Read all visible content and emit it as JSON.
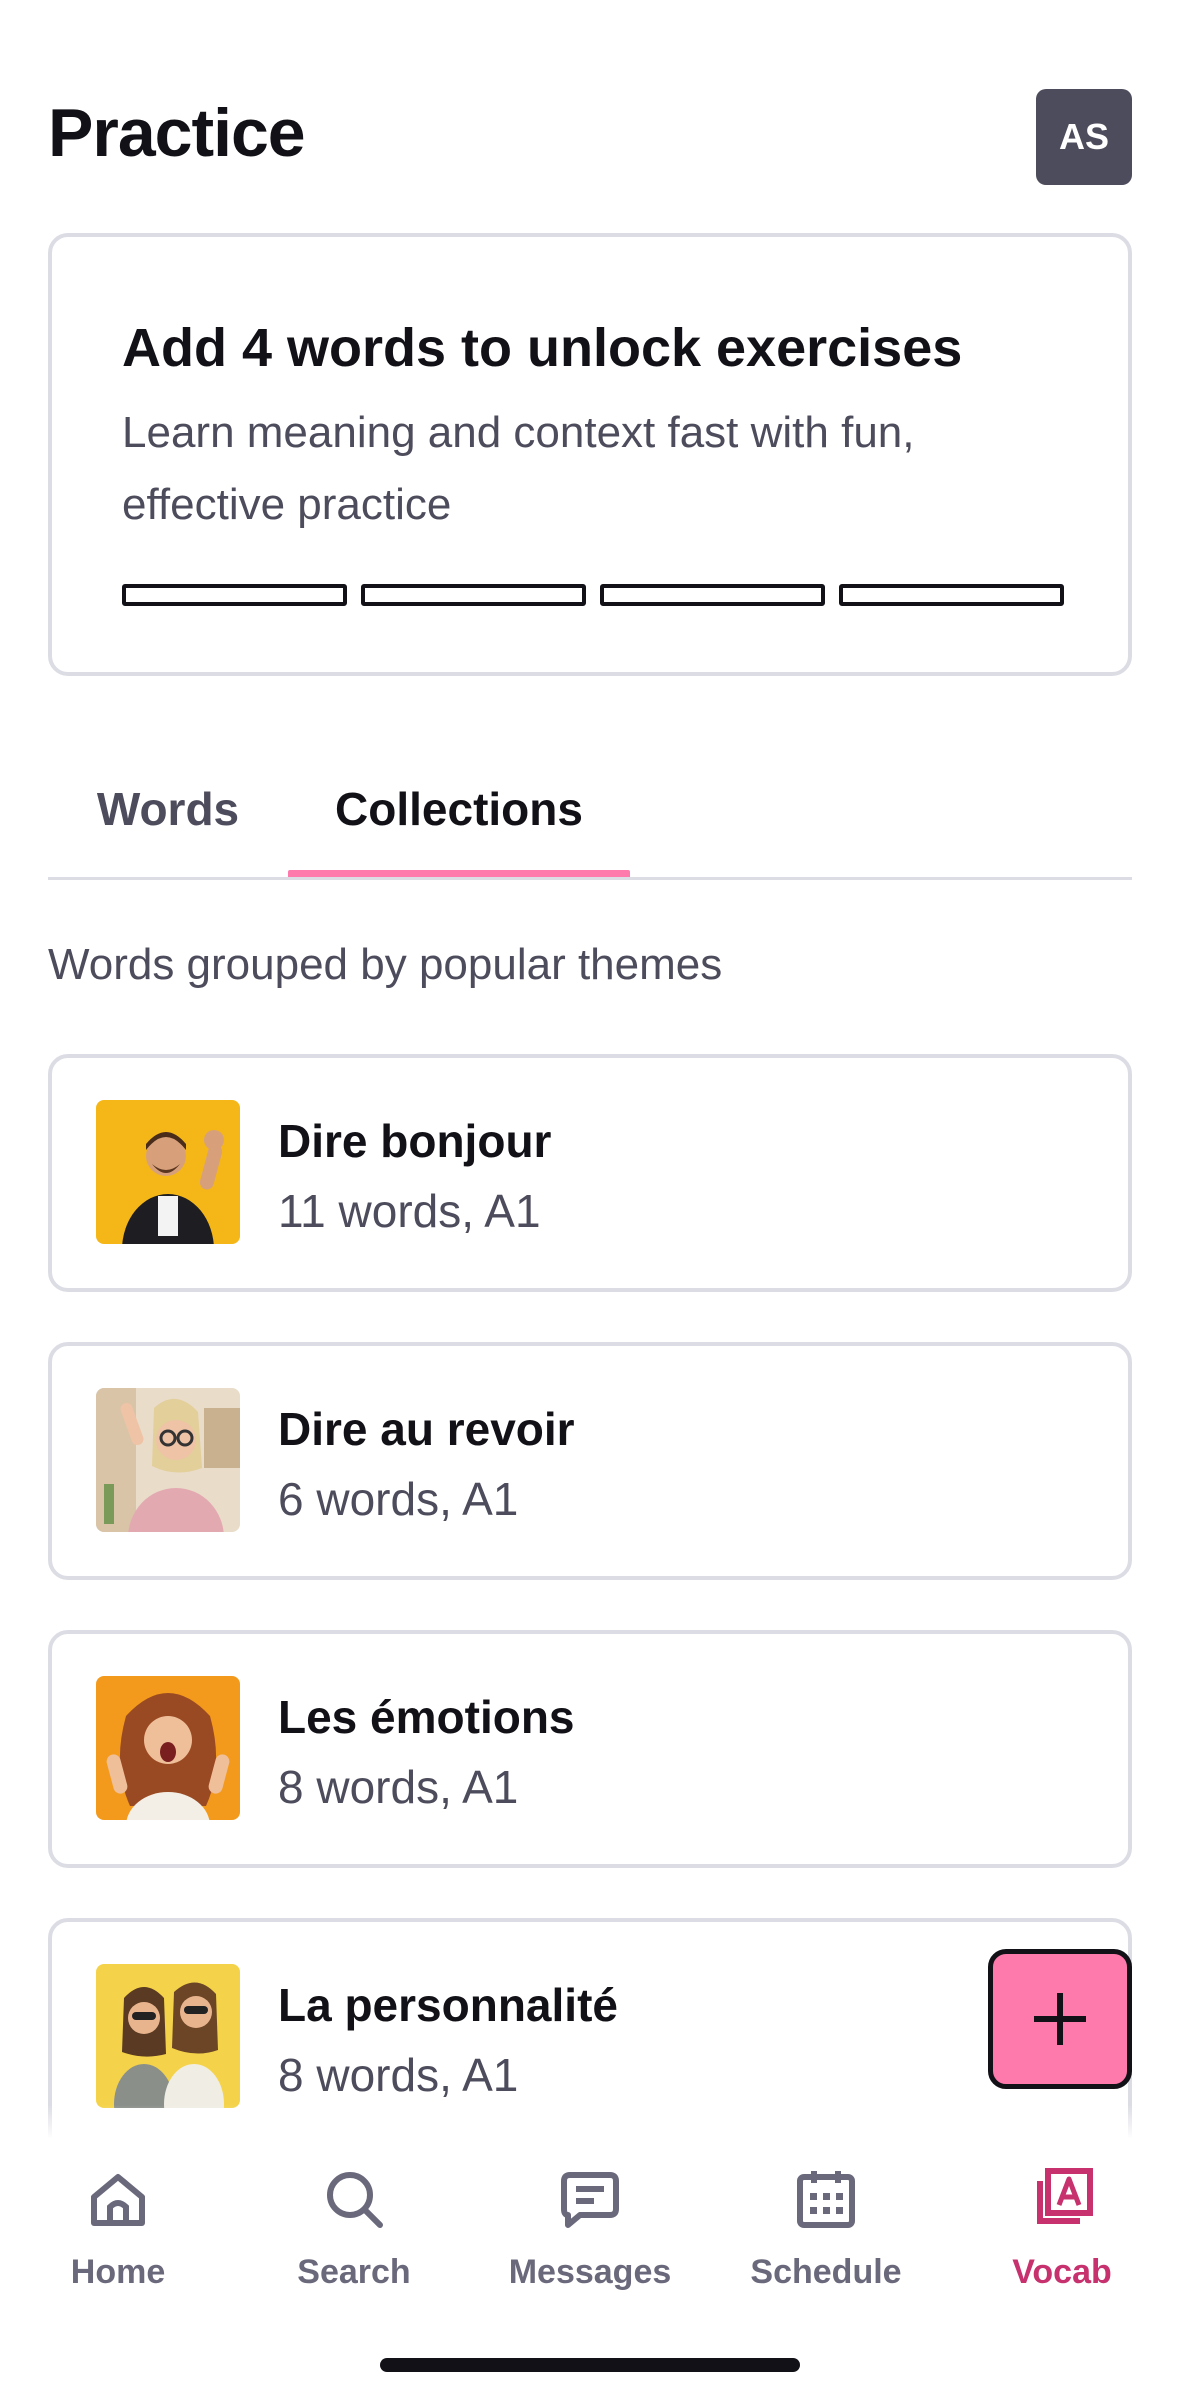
{
  "header": {
    "title": "Practice",
    "avatar_initials": "AS"
  },
  "unlock_card": {
    "title": "Add 4 words to unlock exercises",
    "subtitle": "Learn meaning and context fast with fun, effective practice",
    "progress_filled": 0,
    "progress_total": 4
  },
  "tabs": {
    "items": [
      {
        "label": "Words",
        "active": false
      },
      {
        "label": "Collections",
        "active": true
      }
    ]
  },
  "collections_section": {
    "subtitle": "Words grouped by popular themes",
    "items": [
      {
        "name": "Dire bonjour",
        "meta": "11 words, A1",
        "thumb_bg": "#f5b718"
      },
      {
        "name": "Dire au revoir",
        "meta": "6 words, A1",
        "thumb_bg": "#e9dcc9"
      },
      {
        "name": "Les émotions",
        "meta": "8 words, A1",
        "thumb_bg": "#f39a1c"
      },
      {
        "name": "La personnalité",
        "meta": "8 words, A1",
        "thumb_bg": "#f4d34a"
      }
    ]
  },
  "fab": {
    "icon": "plus-icon"
  },
  "bottom_nav": {
    "items": [
      {
        "label": "Home",
        "icon": "home-icon",
        "active": false
      },
      {
        "label": "Search",
        "icon": "search-icon",
        "active": false
      },
      {
        "label": "Messages",
        "icon": "messages-icon",
        "active": false
      },
      {
        "label": "Schedule",
        "icon": "calendar-icon",
        "active": false
      },
      {
        "label": "Vocab",
        "icon": "vocab-icon",
        "active": true
      }
    ]
  },
  "colors": {
    "accent_pink": "#ff7aac",
    "active_nav": "#c7316e",
    "text_primary": "#121117",
    "text_secondary": "#4d4c5c",
    "border": "#dcdce5"
  }
}
